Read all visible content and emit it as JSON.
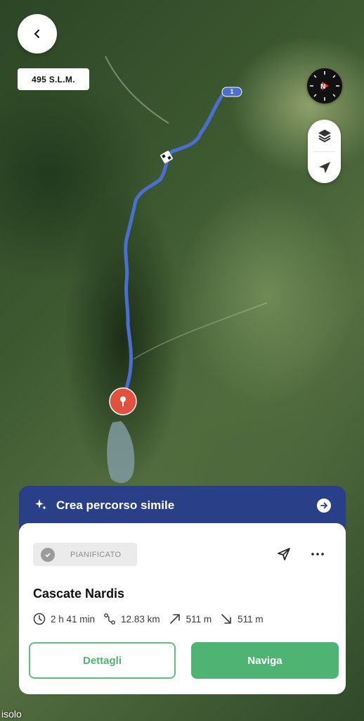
{
  "map": {
    "altitude": "495 S.L.M.",
    "route_start_badge": "1",
    "place_label": "isolo"
  },
  "icons": {
    "back": "chevron-left-icon",
    "compass": "compass-icon",
    "layers": "layers-icon",
    "locate": "navigation-arrow-icon"
  },
  "similar_route": {
    "label": "Crea percorso simile"
  },
  "route_card": {
    "status": "PIANIFICATO",
    "title": "Cascate Nardis",
    "stats": {
      "duration": "2 h 41 min",
      "distance": "12.83 km",
      "ascent": "511 m",
      "descent": "511 m"
    },
    "details_button": "Dettagli",
    "navigate_button": "Naviga"
  },
  "colors": {
    "accent_green": "#4fb374",
    "banner_blue": "#293f87",
    "route_blue": "#4a6fd1",
    "pin_red": "#e0513f"
  }
}
